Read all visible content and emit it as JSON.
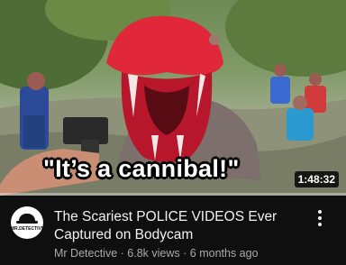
{
  "video": {
    "thumbnail_caption": "\"It’s a cannibal!\"",
    "duration": "1:48:32",
    "watch_progress": 0.0,
    "title": "The Scariest POLICE VIDEOS Ever Captured on Bodycam",
    "channel_name": "Mr Detective",
    "views": "6.8k views",
    "separator": "·",
    "age": "6 months ago"
  },
  "channel_avatar": {
    "logo_text": "MR.DETECTIVE"
  },
  "icons": {
    "menu": "more-vert-icon"
  },
  "colors": {
    "background": "#0f0f0f",
    "title": "#f1f1f1",
    "secondary": "#aaaaaa",
    "hippo_mouth": "#e0283a"
  }
}
